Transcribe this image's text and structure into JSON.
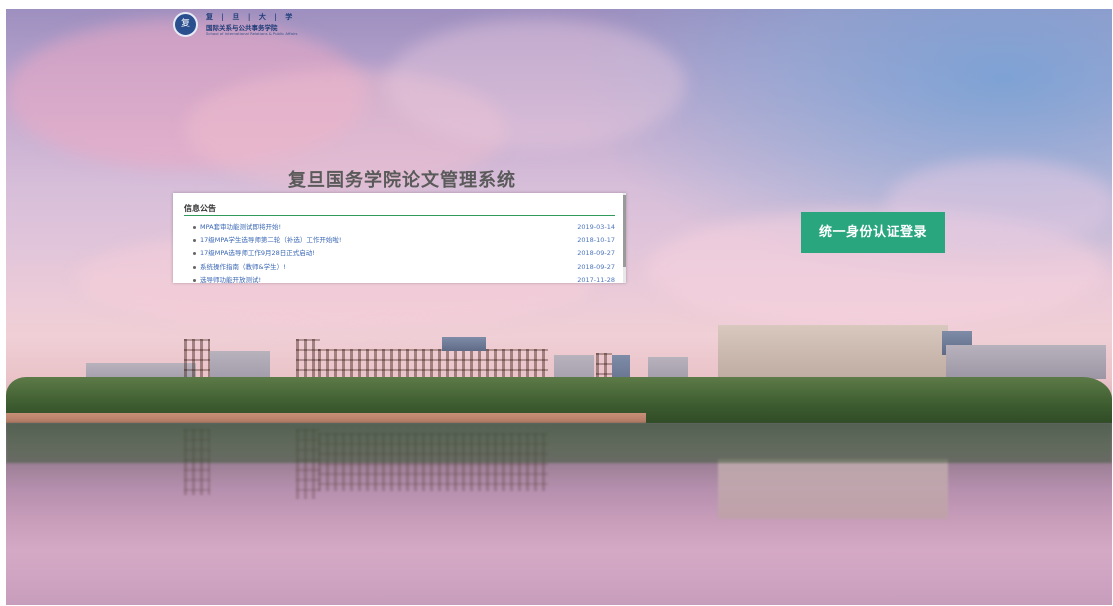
{
  "logo": {
    "emblem_text": "复",
    "line1": "复 | 旦 | 大 | 学",
    "line2": "国际关系与公共事务学院",
    "line3": "School of International Relations & Public Affairs"
  },
  "system_title": "复旦国务学院论文管理系统",
  "notice": {
    "header": "信息公告",
    "items": [
      {
        "title": "MPA套审功能测试即将开始!",
        "date": "2019-03-14"
      },
      {
        "title": "17级MPA学生选导师第二轮（补选）工作开始啦!",
        "date": "2018-10-17"
      },
      {
        "title": "17级MPA选导师工作9月28日正式启动!",
        "date": "2018-09-27"
      },
      {
        "title": "系统操作指南（教师&学生）!",
        "date": "2018-09-27"
      },
      {
        "title": "选导师功能开放测试!",
        "date": "2017-11-28"
      }
    ]
  },
  "login_button": {
    "label": "统一身份认证登录"
  },
  "colors": {
    "accent_green": "#29a67e",
    "link_blue": "#3a67b5",
    "rule_green": "#2f9a5a"
  }
}
